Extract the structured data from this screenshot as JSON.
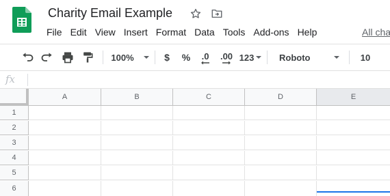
{
  "app": {
    "logo_icon": "google-sheets-logo",
    "logo_color": "#0f9d58"
  },
  "header": {
    "title": "Charity Email Example",
    "star_icon": "star-outline-icon",
    "move_icon": "folder-move-icon"
  },
  "menu": {
    "items": [
      "File",
      "Edit",
      "View",
      "Insert",
      "Format",
      "Data",
      "Tools",
      "Add-ons",
      "Help"
    ],
    "all_changes": "All cha"
  },
  "toolbar": {
    "zoom": "100%",
    "currency": "$",
    "percent": "%",
    "decrease_decimal": ".0",
    "increase_decimal": ".00",
    "more_formats": "123",
    "font": "Roboto",
    "font_size": "10"
  },
  "formula_bar": {
    "fx_label": "fx",
    "value": ""
  },
  "grid": {
    "columns": [
      "A",
      "B",
      "C",
      "D",
      "E"
    ],
    "rows": [
      "1",
      "2",
      "3",
      "4",
      "5",
      "6"
    ],
    "selected_column": "E",
    "accent": "#1a73e8"
  }
}
